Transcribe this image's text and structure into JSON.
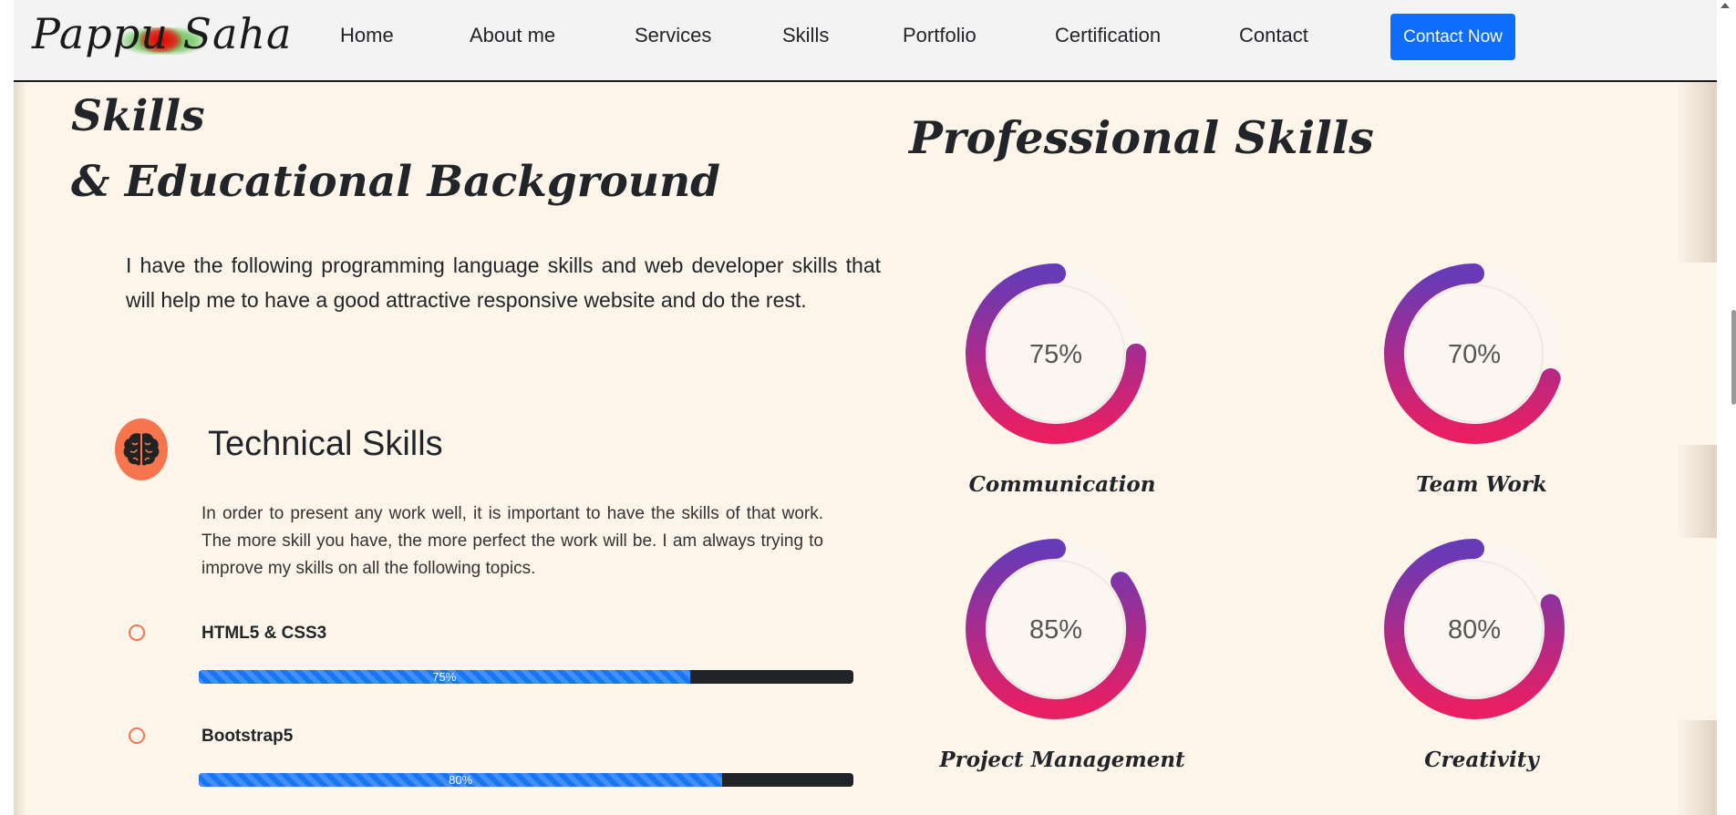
{
  "nav": {
    "logo_text": "Pappu Saha",
    "items": [
      "Home",
      "About me",
      "Services",
      "Skills",
      "Portfolio",
      "Certification",
      "Contact"
    ],
    "cta": "Contact Now"
  },
  "skills": {
    "heading_line1": "Skills",
    "heading_line2": "& Educational Background",
    "intro": "I have the following programming language skills and web developer skills that will help me to have a good attractive responsive website and do the rest."
  },
  "technical": {
    "icon": "brain-icon",
    "title": "Technical Skills",
    "description": "In order to present any work well, it is important to have the skills of that work. The more skill you have, the more perfect the work will be. I am always trying to improve my skills on all the following topics.",
    "items": [
      {
        "name": "HTML5 & CSS3",
        "percent": 75,
        "label": "75%"
      },
      {
        "name": "Bootstrap5",
        "percent": 80,
        "label": "80%"
      }
    ]
  },
  "professional": {
    "title": "Professional Skills",
    "items": [
      {
        "name": "Communication",
        "percent": 75,
        "label": "75%"
      },
      {
        "name": "Team Work",
        "percent": 70,
        "label": "70%"
      },
      {
        "name": "Project Management",
        "percent": 85,
        "label": "85%"
      },
      {
        "name": "Creativity",
        "percent": 80,
        "label": "80%"
      }
    ]
  },
  "colors": {
    "accent": "#0d6efd",
    "orange": "#f6754f",
    "ring_start": "#e91e63",
    "ring_end": "#673ab7",
    "background": "#fdf5ea"
  }
}
